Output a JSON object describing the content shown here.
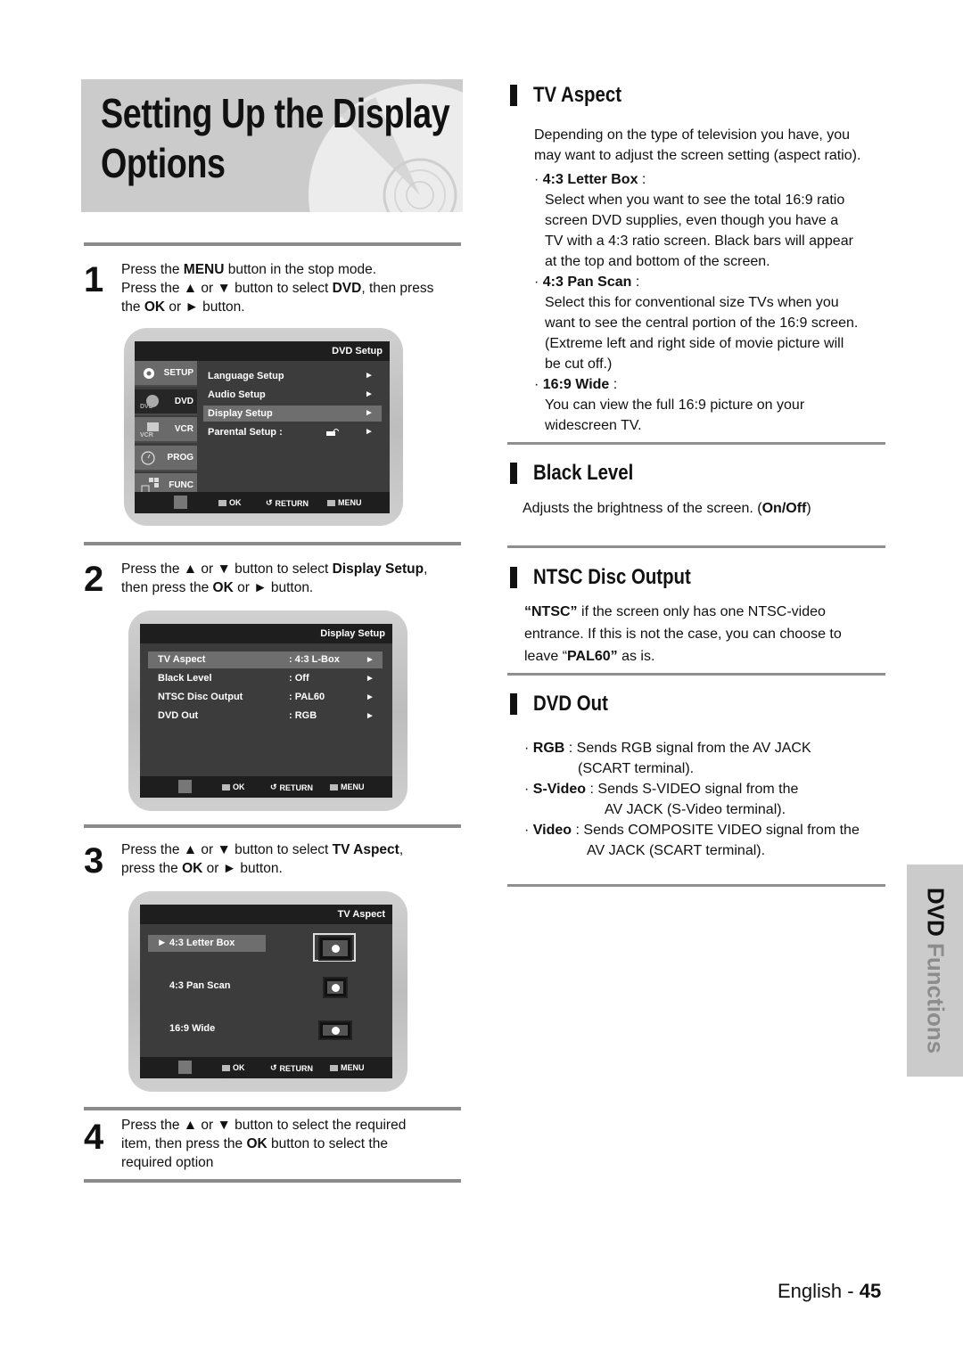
{
  "page": {
    "title_line1": "Setting Up the Display",
    "title_line2": "Options",
    "side_tab": {
      "part1": "DVD",
      "part2": "Functions"
    },
    "footer": {
      "language": "English",
      "separator": "-",
      "page_number": "45"
    }
  },
  "steps": [
    {
      "number": "1",
      "lines": [
        [
          "Press the ",
          {
            "b": "MENU"
          },
          " button in the stop mode."
        ],
        [
          "Press the ▲ or ▼ button to select ",
          {
            "b": "DVD"
          },
          ", then press"
        ],
        [
          "the ",
          {
            "b": "OK"
          },
          " or ► button."
        ]
      ]
    },
    {
      "number": "2",
      "lines": [
        [
          "Press the ▲ or ▼ button to select ",
          {
            "b": "Display Setup"
          },
          ","
        ],
        [
          "then press the ",
          {
            "b": "OK"
          },
          " or ► button."
        ]
      ]
    },
    {
      "number": "3",
      "lines": [
        [
          "Press the ▲ or ▼ button to select ",
          {
            "b": "TV Aspect"
          },
          ","
        ],
        [
          "press the ",
          {
            "b": "OK"
          },
          " or ► button."
        ]
      ]
    },
    {
      "number": "4",
      "lines": [
        [
          "Press the ▲ or ▼ button to select the required"
        ],
        [
          "item, then press the ",
          {
            "b": "OK"
          },
          " button to select the"
        ],
        [
          "required option"
        ]
      ]
    }
  ],
  "osd_common": {
    "footer_ok": "OK",
    "footer_return": "RETURN",
    "footer_menu": "MENU"
  },
  "osd1": {
    "header": "DVD  Setup",
    "side_tabs": [
      {
        "label": "SETUP",
        "icon": "gear-icon",
        "active": false
      },
      {
        "label": "DVD",
        "icon": "dvd-disc-icon",
        "active": true
      },
      {
        "label": "VCR",
        "icon": "vcr-icon",
        "active": false
      },
      {
        "label": "PROG",
        "icon": "clock-icon",
        "active": false
      },
      {
        "label": "FUNC",
        "icon": "hand-icon",
        "active": false
      }
    ],
    "items": [
      {
        "label": "Language Setup",
        "selected": false
      },
      {
        "label": "Audio Setup",
        "selected": false
      },
      {
        "label": "Display Setup",
        "selected": true
      },
      {
        "label": "Parental Setup :",
        "selected": false,
        "lock_icon": "unlocked-icon"
      }
    ]
  },
  "osd2": {
    "header": "Display Setup",
    "items": [
      {
        "label": "TV Aspect",
        "value": ": 4:3 L-Box",
        "selected": true
      },
      {
        "label": "Black Level",
        "value": ": Off",
        "selected": false
      },
      {
        "label": "NTSC Disc Output",
        "value": ": PAL60",
        "selected": false
      },
      {
        "label": "DVD Out",
        "value": ": RGB",
        "selected": false
      }
    ]
  },
  "osd3": {
    "header": "TV Aspect",
    "options": [
      {
        "label": "4:3 Letter Box",
        "selected": true,
        "icon": "tv-letterbox-icon"
      },
      {
        "label": "4:3 Pan Scan",
        "selected": false,
        "icon": "tv-panscan-icon"
      },
      {
        "label": "16:9 Wide",
        "selected": false,
        "icon": "tv-wide-icon"
      }
    ],
    "selected_marker": "►"
  },
  "sections": {
    "tv_aspect": {
      "title": "TV Aspect",
      "intro": [
        "Depending on the type of television you have, you",
        "may want to adjust the screen setting (aspect ratio)."
      ],
      "options": [
        {
          "name": "4:3 Letter Box",
          "desc": [
            "Select when you want to see the total 16:9 ratio",
            "screen DVD  supplies, even  though you have a",
            "TV with a 4:3 ratio screen. Black bars will appear",
            "at the top and bottom of the screen."
          ]
        },
        {
          "name": "4:3 Pan Scan",
          "desc": [
            "Select this for conventional size TVs when you",
            "want to see the central portion of the 16:9 screen.",
            "(Extreme left and right  side  of movie picture will",
            "be cut off.)"
          ]
        },
        {
          "name": "16:9 Wide",
          "desc": [
            "You can view the full 16:9 picture on your",
            "widescreen TV."
          ]
        }
      ]
    },
    "black_level": {
      "title": "Black Level",
      "text": "Adjusts the brightness of the screen. (",
      "bold": "On/Off",
      "tail": ")"
    },
    "ntsc": {
      "title": "NTSC Disc Output",
      "line1_bold": "“NTSC”",
      "line1_rest": " if the screen only has one NTSC-video",
      "line2": "entrance. If this is not the case, you can choose to",
      "line3_pre": "leave “",
      "line3_bold": "PAL60”",
      "line3_post": " as is."
    },
    "dvd_out": {
      "title": "DVD Out",
      "items": [
        {
          "name": "RGB",
          "text": " : Sends RGB signal from the AV JACK",
          "cont": "(SCART terminal)."
        },
        {
          "name": "S-Video",
          "text": " : Sends S-VIDEO signal from the",
          "cont": "AV JACK (S-Video terminal)."
        },
        {
          "name": "Video",
          "text": " : Sends COMPOSITE VIDEO signal from the",
          "cont": "AV JACK (SCART terminal)."
        }
      ]
    }
  }
}
